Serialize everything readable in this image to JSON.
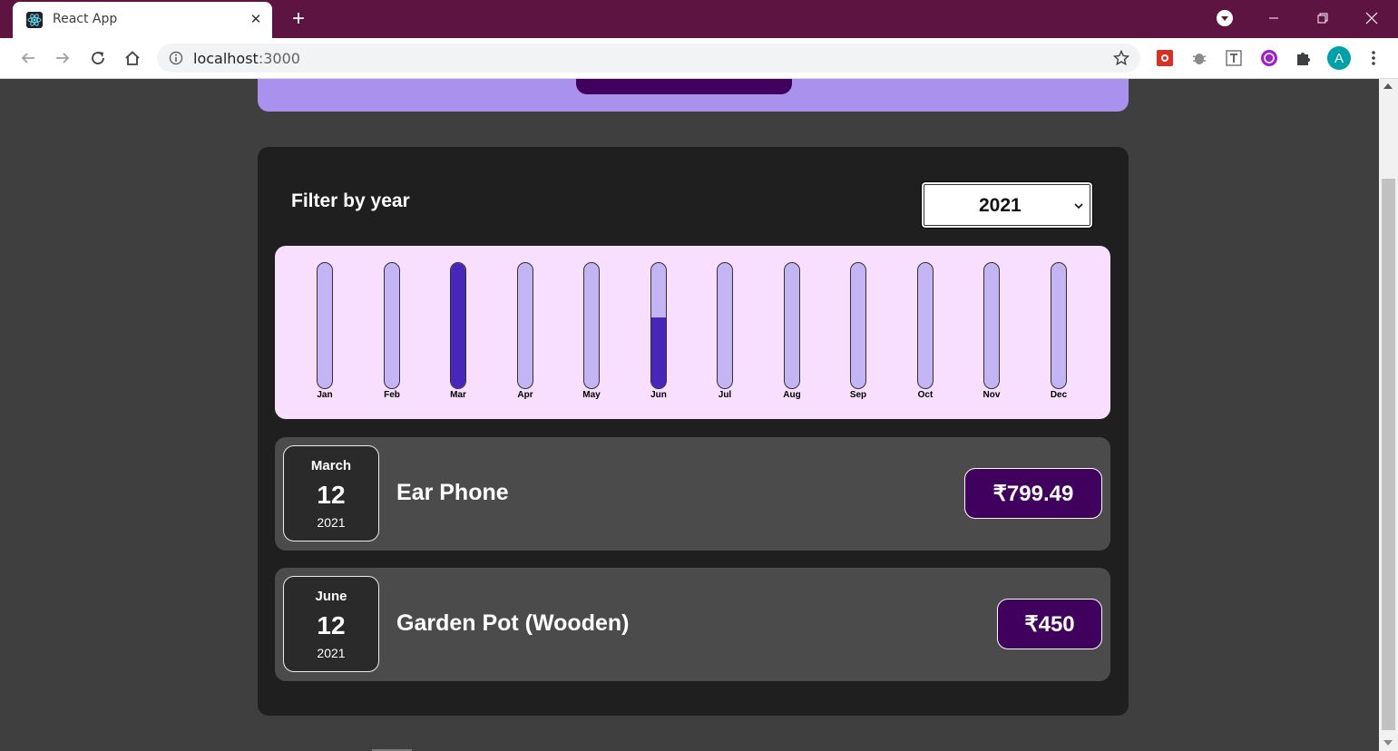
{
  "browser": {
    "tab_title": "React App",
    "url_host": "localhost",
    "url_port": ":3000"
  },
  "filter": {
    "label": "Filter by year",
    "selected_year": "2021"
  },
  "chart_data": {
    "type": "bar",
    "categories": [
      "Jan",
      "Feb",
      "Mar",
      "Apr",
      "May",
      "Jun",
      "Jul",
      "Aug",
      "Sep",
      "Oct",
      "Nov",
      "Dec"
    ],
    "values": [
      0,
      0,
      799.49,
      0,
      0,
      450,
      0,
      0,
      0,
      0,
      0,
      0
    ],
    "max": 799.49,
    "fill_color": "#4826b9",
    "track_color": "#c3b4f3"
  },
  "expenses": [
    {
      "month": "March",
      "day": "12",
      "year": "2021",
      "title": "Ear Phone",
      "amount": "₹799.49"
    },
    {
      "month": "June",
      "day": "12",
      "year": "2021",
      "title": "Garden Pot (Wooden)",
      "amount": "₹450"
    }
  ],
  "colors": {
    "titlebar": "#5e1440",
    "accent_purple": "#40005d",
    "header_card": "#a892ee",
    "chart_bg": "#f8dfff",
    "page_bg": "#3f3f3f",
    "card_bg": "#1f1f1f",
    "item_bg": "#4b4b4b"
  },
  "icons": [
    "react-icon",
    "close-icon",
    "plus-icon",
    "profile-menu-icon",
    "minimize-icon",
    "restore-icon",
    "window-close-icon",
    "back-icon",
    "forward-icon",
    "reload-icon",
    "home-icon",
    "info-icon",
    "star-icon",
    "extension-icon",
    "puzzle-icon",
    "kebab-menu-icon"
  ],
  "profile_initial": "A"
}
